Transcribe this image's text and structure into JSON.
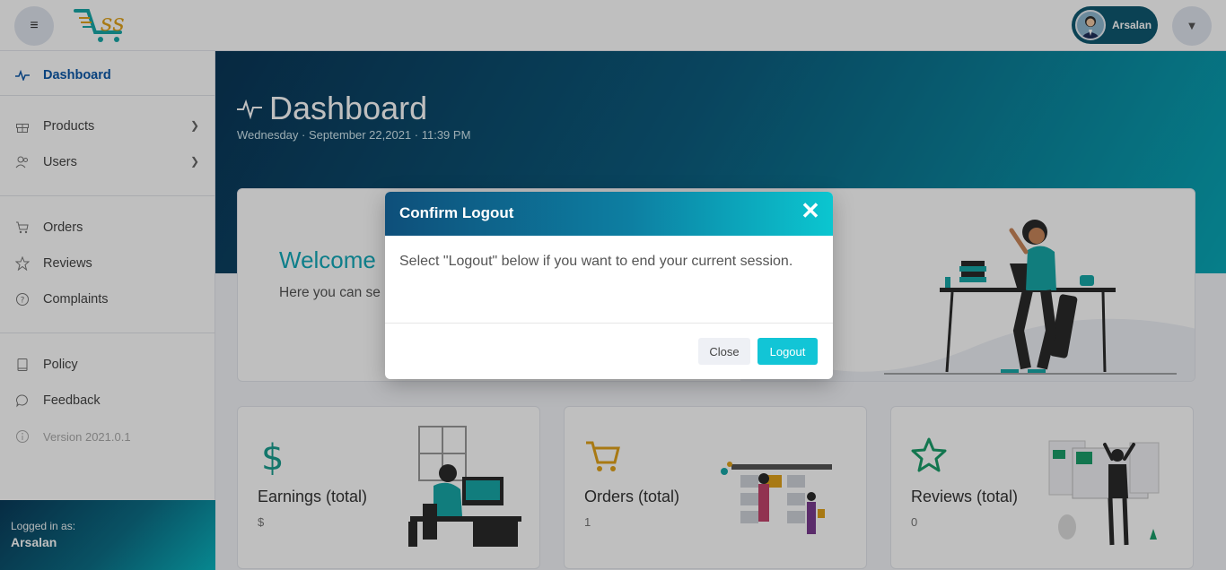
{
  "header": {
    "menu_icon": "hamburger-icon",
    "logo_icon": "cart-logo-icon",
    "user_name": "Arsalan",
    "dropdown_icon": "caret-down-icon"
  },
  "sidebar": {
    "items": [
      {
        "label": "Dashboard",
        "icon": "pulse-icon",
        "active": true
      },
      {
        "label": "Products",
        "icon": "gift-icon",
        "has_children": true
      },
      {
        "label": "Users",
        "icon": "users-icon",
        "has_children": true
      },
      {
        "label": "Orders",
        "icon": "cart-icon"
      },
      {
        "label": "Reviews",
        "icon": "star-icon"
      },
      {
        "label": "Complaints",
        "icon": "question-icon"
      },
      {
        "label": "Policy",
        "icon": "book-icon"
      },
      {
        "label": "Feedback",
        "icon": "chat-icon"
      },
      {
        "label": "Version 2021.0.1",
        "icon": "info-icon"
      }
    ],
    "logged_in_label": "Logged in as:",
    "logged_in_user": "Arsalan"
  },
  "page": {
    "title": "Dashboard",
    "date": "Wednesday · September 22,2021 · 11:39 PM"
  },
  "welcome": {
    "title": "Welcome",
    "text": "Here you can se Reviews & Penc"
  },
  "stats": [
    {
      "title": "Earnings (total)",
      "value": "$",
      "icon": "dollar-icon",
      "color": "#1a9e8f"
    },
    {
      "title": "Orders (total)",
      "value": "1",
      "icon": "cart-icon",
      "color": "#e0a21a"
    },
    {
      "title": "Reviews (total)",
      "value": "0",
      "icon": "star-icon",
      "color": "#1a9e6a"
    }
  ],
  "modal": {
    "title": "Confirm Logout",
    "body": "Select \"Logout\" below if you want to end your current session.",
    "close_label": "Close",
    "logout_label": "Logout"
  }
}
